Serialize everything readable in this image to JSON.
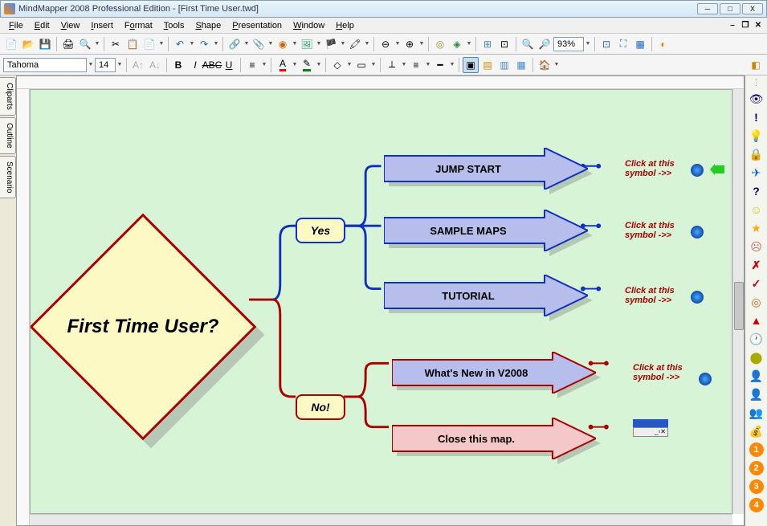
{
  "window": {
    "title": "MindMapper 2008 Professional Edition - [First Time User.twd]"
  },
  "menu": {
    "items": [
      "File",
      "Edit",
      "View",
      "Insert",
      "Format",
      "Tools",
      "Shape",
      "Presentation",
      "Window",
      "Help"
    ]
  },
  "toolbar1": {
    "zoom": "93%"
  },
  "toolbar2": {
    "font": "Tahoma",
    "size": "14"
  },
  "sidebar": {
    "tabs": [
      "Cliparts",
      "Outline",
      "Scenario"
    ]
  },
  "map": {
    "root": "First Time User?",
    "yes_label": "Yes",
    "no_label": "No!",
    "yes_branches": [
      {
        "label": "JUMP START",
        "hint": "Click at this symbol ->>"
      },
      {
        "label": "SAMPLE MAPS",
        "hint": "Click at this symbol ->>"
      },
      {
        "label": "TUTORIAL",
        "hint": "Click at this symbol ->>"
      }
    ],
    "no_branches": [
      {
        "label": "What's New in V2008",
        "hint": "Click at this symbol ->>"
      },
      {
        "label": "Close this map.",
        "hint": ""
      }
    ]
  },
  "right_icons": [
    "eye-icon",
    "exclaim-icon",
    "lightbulb-icon",
    "lock-icon",
    "plane-icon",
    "question-icon",
    "smile-icon",
    "star-icon",
    "sad-icon",
    "x-red-icon",
    "check-red-icon",
    "target-icon",
    "up-arrow-icon",
    "pin-icon",
    "clock-icon",
    "person1-icon",
    "person2-icon",
    "people-icon",
    "money-icon",
    "num1-icon",
    "num2-icon",
    "num3-icon",
    "num4-icon"
  ]
}
